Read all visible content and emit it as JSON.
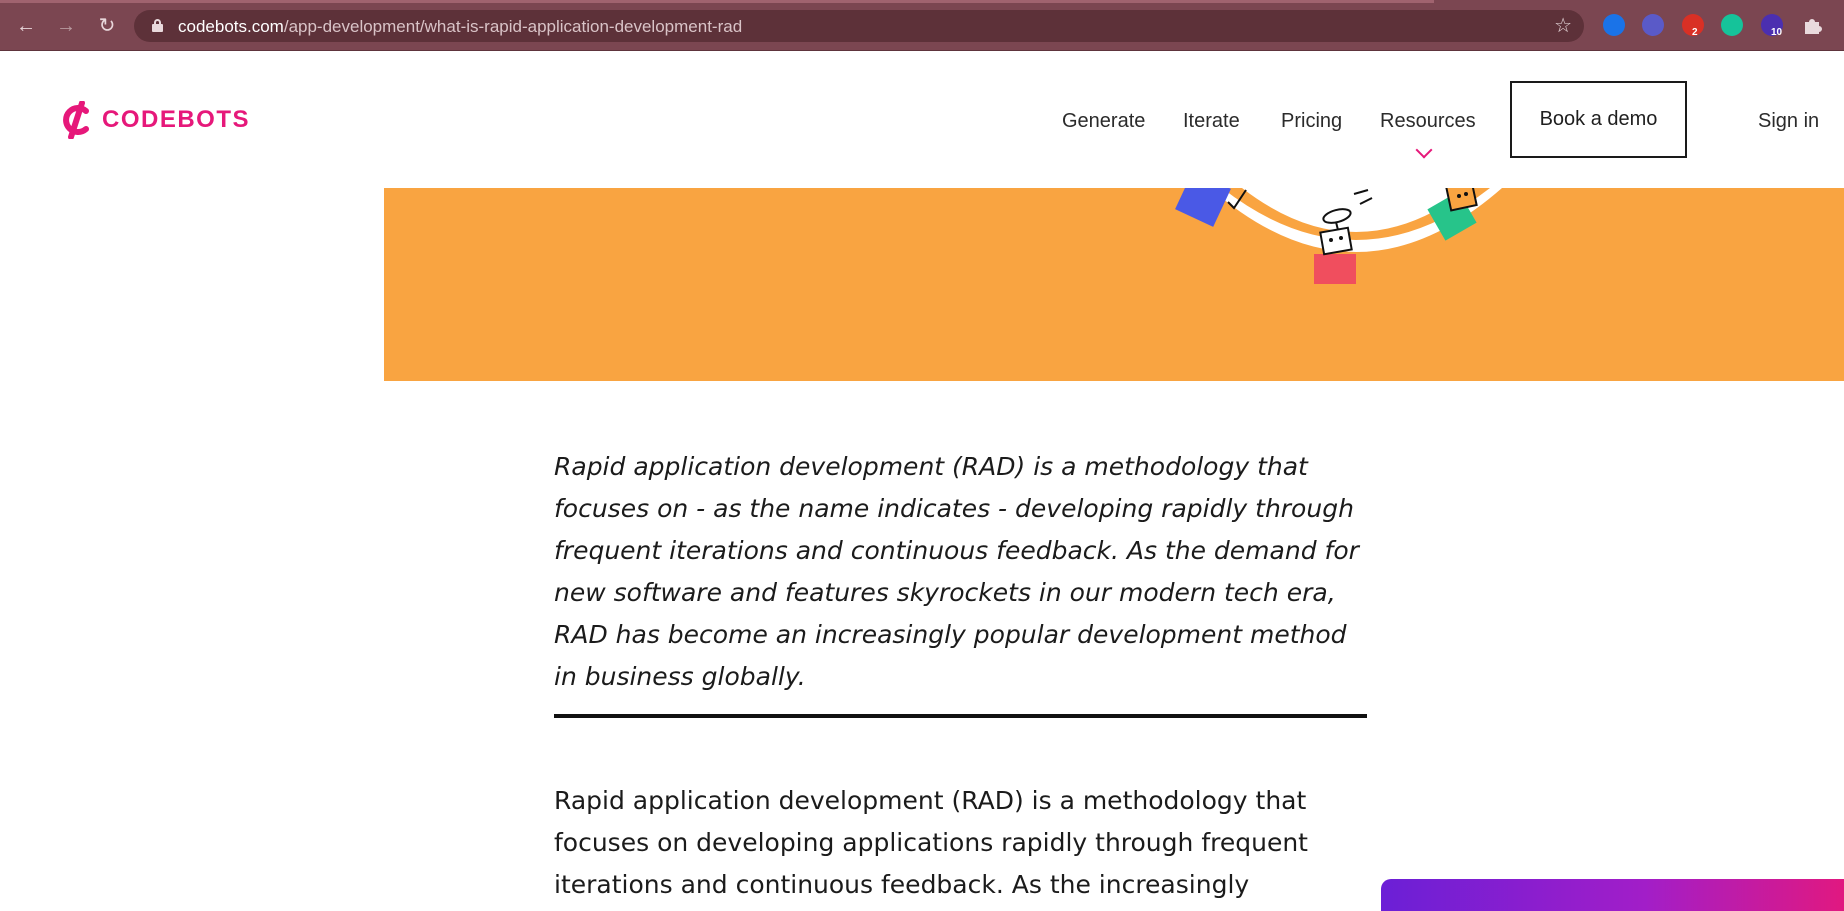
{
  "browser": {
    "url_host": "codebots.com",
    "url_path": "/app-development/what-is-rapid-application-development-rad",
    "extensions": [
      {
        "name": "translate-extension-icon",
        "color": "#1a73e8"
      },
      {
        "name": "blocker-extension-icon",
        "color": "#5a5ac8"
      },
      {
        "name": "hand-extension-icon",
        "color": "#d93025",
        "badge": "2"
      },
      {
        "name": "grammarly-extension-icon",
        "color": "#15c39a"
      },
      {
        "name": "cap-extension-icon",
        "color": "#4b2fb0",
        "badge": "10"
      },
      {
        "name": "puzzle-extension-icon",
        "color": "#e9dadd"
      }
    ]
  },
  "header": {
    "logo_text": "CODEBOTS",
    "nav": [
      "Generate",
      "Iterate",
      "Pricing",
      "Resources"
    ],
    "cta": "Book a demo",
    "signin": "Sign in"
  },
  "article": {
    "lead": "Rapid application development (RAD) is a methodology that focuses on - as the name indicates - developing rapidly through frequent iterations and continuous feedback. As the demand for new software and features skyrockets in our modern tech era, RAD has become an increasingly popular development method in business globally.",
    "body": "Rapid application development (RAD) is a methodology that focuses on developing applications rapidly through frequent iterations and continuous feedback. As the increasingly competitive software market"
  },
  "colors": {
    "brand": "#e6187a",
    "hero_bg": "#f9a441",
    "chrome": "#7b4651"
  }
}
